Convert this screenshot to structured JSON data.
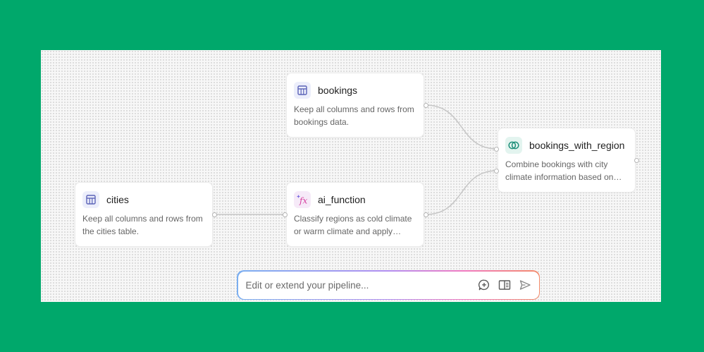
{
  "nodes": {
    "bookings": {
      "title": "bookings",
      "desc": "Keep all columns and rows from bookings data."
    },
    "cities": {
      "title": "cities",
      "desc": "Keep all columns and rows from the cities table."
    },
    "ai_function": {
      "title": "ai_function",
      "desc": "Classify regions as cold climate or warm climate and apply classification to cities data."
    },
    "bookings_with_region": {
      "title": "bookings_with_region",
      "desc": "Combine bookings with city climate information based on matching city names."
    }
  },
  "prompt": {
    "placeholder": "Edit or extend your pipeline..."
  },
  "colors": {
    "background": "#00a86b",
    "table_icon": "#5b63b8",
    "join_icon": "#1f8f7a",
    "fx_icon": "#d6409f"
  }
}
